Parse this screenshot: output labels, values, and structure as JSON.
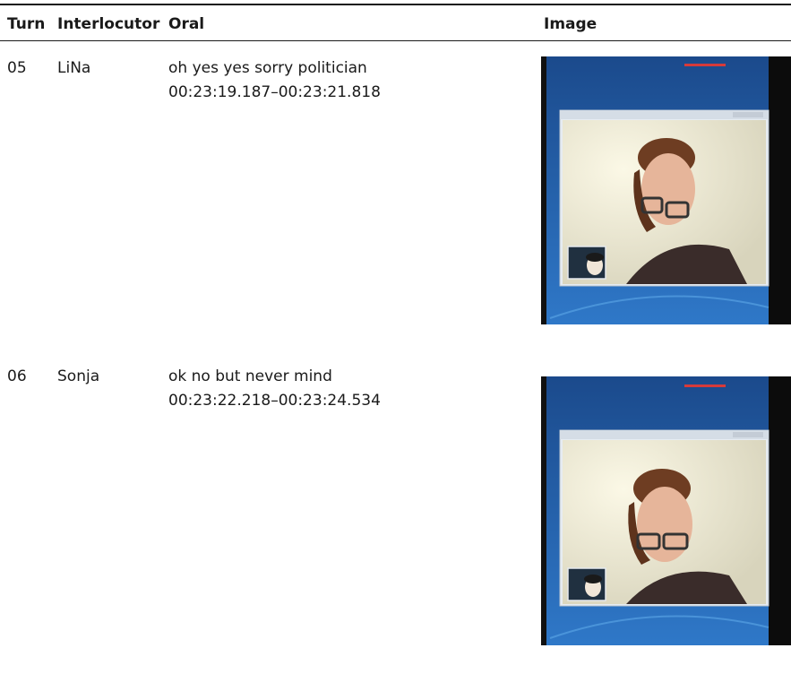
{
  "table": {
    "headers": {
      "turn": "Turn",
      "interlocutor": "Interlocutor",
      "oral": "Oral",
      "image": "Image"
    },
    "rows": [
      {
        "turn": "05",
        "interlocutor": "LiNa",
        "oral": "oh yes yes sorry politician",
        "timecode": "00:23:19.187–00:23:21.818"
      },
      {
        "turn": "06",
        "interlocutor": "Sonja",
        "oral": "ok no but never mind",
        "timecode": "00:23:22.218–00:23:24.534"
      }
    ]
  },
  "colors": {
    "rule": "#1a1a1a",
    "screen_blue": "#1e4f8f",
    "window_bg": "#f4f1dc"
  }
}
